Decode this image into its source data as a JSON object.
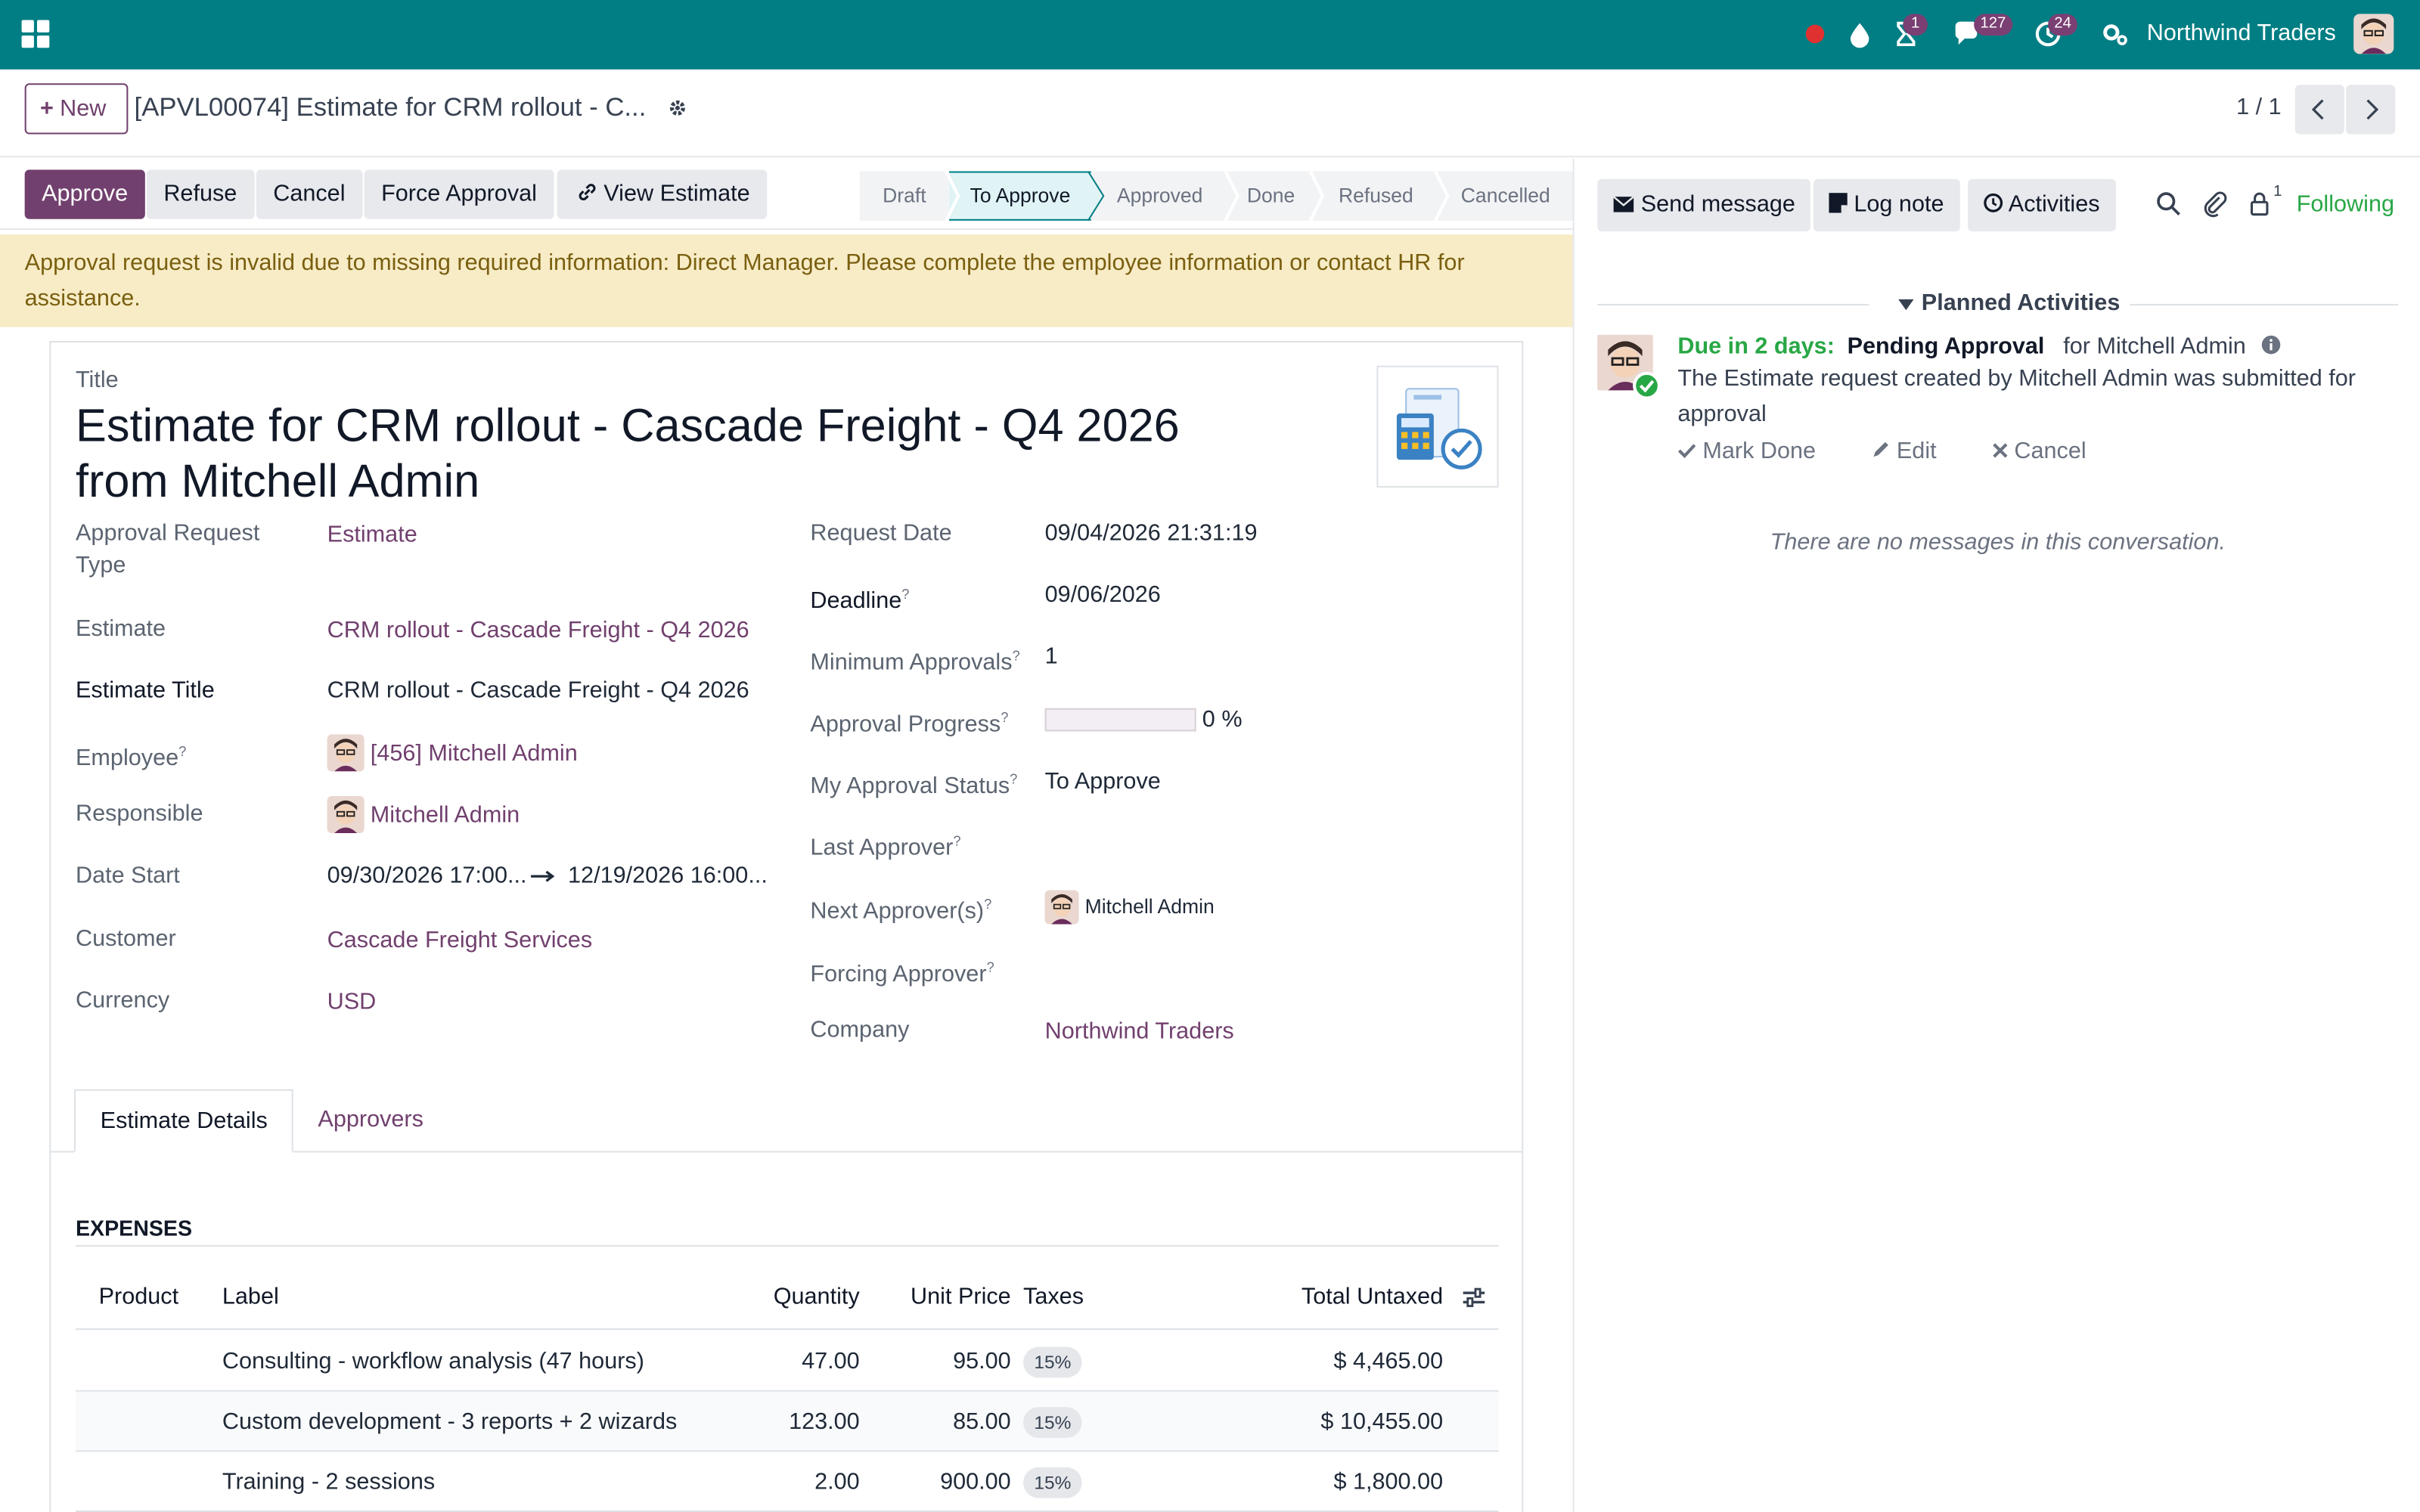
{
  "navbar": {
    "company": "Northwind Traders",
    "badges": {
      "activities": "1",
      "messages": "127",
      "clock": "24"
    },
    "colors": {
      "bar": "#017e84",
      "badge": "#7a3f73",
      "record": "#e03131"
    },
    "icons": [
      "apps-grid-icon",
      "record-dot-icon",
      "drop-icon",
      "hourglass-icon",
      "chat-icon",
      "clock-icon",
      "settings-icon",
      "user-avatar"
    ]
  },
  "control_panel": {
    "new_label": "New",
    "breadcrumb": "[APVL00074] Estimate for CRM rollout - C...",
    "pager": "1 / 1"
  },
  "status_buttons": {
    "approve": "Approve",
    "refuse": "Refuse",
    "cancel": "Cancel",
    "force_approval": "Force Approval",
    "view_estimate": "View Estimate"
  },
  "stages": [
    {
      "label": "Draft",
      "active": false
    },
    {
      "label": "To Approve",
      "active": true
    },
    {
      "label": "Approved",
      "active": false
    },
    {
      "label": "Done",
      "active": false
    },
    {
      "label": "Refused",
      "active": false
    },
    {
      "label": "Cancelled",
      "active": false
    }
  ],
  "alert": "Approval request is invalid due to missing required information: Direct Manager. Please complete the employee information or contact HR for assistance.",
  "form": {
    "title_label": "Title",
    "title": "Estimate for CRM rollout - Cascade Freight - Q4 2026 from Mitchell Admin",
    "left": {
      "type_label": "Approval Request Type",
      "type": "Estimate",
      "estimate_label": "Estimate",
      "estimate": "CRM rollout - Cascade Freight - Q4 2026",
      "estimate_title_label": "Estimate Title",
      "estimate_title": "CRM rollout - Cascade Freight - Q4 2026",
      "employee_label": "Employee",
      "employee": "[456] Mitchell Admin",
      "responsible_label": "Responsible",
      "responsible": "Mitchell Admin",
      "date_start_label": "Date Start",
      "date_start": "09/30/2026 17:00...",
      "date_end": "12/19/2026 16:00...",
      "customer_label": "Customer",
      "customer": "Cascade Freight Services",
      "currency_label": "Currency",
      "currency": "USD"
    },
    "right": {
      "request_date_label": "Request Date",
      "request_date": "09/04/2026 21:31:19",
      "deadline_label": "Deadline",
      "deadline": "09/06/2026",
      "min_approvals_label": "Minimum Approvals",
      "min_approvals": "1",
      "progress_label": "Approval Progress",
      "progress": "0 %",
      "progress_fraction": 0,
      "my_status_label": "My Approval Status",
      "my_status": "To Approve",
      "last_approver_label": "Last Approver",
      "next_approver_label": "Next Approver(s)",
      "next_approver": "Mitchell Admin",
      "forcing_approver_label": "Forcing Approver",
      "company_label": "Company",
      "company": "Northwind Traders"
    },
    "tabs": [
      "Estimate Details",
      "Approvers"
    ],
    "expenses_title": "EXPENSES",
    "table": {
      "headers": [
        "Product",
        "Label",
        "Quantity",
        "Unit Price",
        "Taxes",
        "Total Untaxed"
      ],
      "rows": [
        {
          "product": "",
          "label": "Consulting - workflow analysis (47 hours)",
          "quantity": "47.00",
          "unit_price": "95.00",
          "taxes": "15%",
          "total": "$ 4,465.00"
        },
        {
          "product": "",
          "label": "Custom development - 3 reports + 2 wizards",
          "quantity": "123.00",
          "unit_price": "85.00",
          "taxes": "15%",
          "total": "$ 10,455.00"
        },
        {
          "product": "",
          "label": "Training - 2 sessions",
          "quantity": "2.00",
          "unit_price": "900.00",
          "taxes": "15%",
          "total": "$ 1,800.00"
        }
      ]
    }
  },
  "chatter": {
    "send_message": "Send message",
    "log_note": "Log note",
    "activities": "Activities",
    "attachments_count": "1",
    "following": "Following",
    "planned_title": "Planned Activities",
    "activity": {
      "due": "Due in 2 days:",
      "type": "Pending Approval",
      "for": "for Mitchell Admin",
      "description": "The Estimate request created by Mitchell Admin was submitted for approval",
      "mark_done": "Mark Done",
      "edit": "Edit",
      "cancel": "Cancel"
    },
    "empty": "There are no messages in this conversation."
  }
}
